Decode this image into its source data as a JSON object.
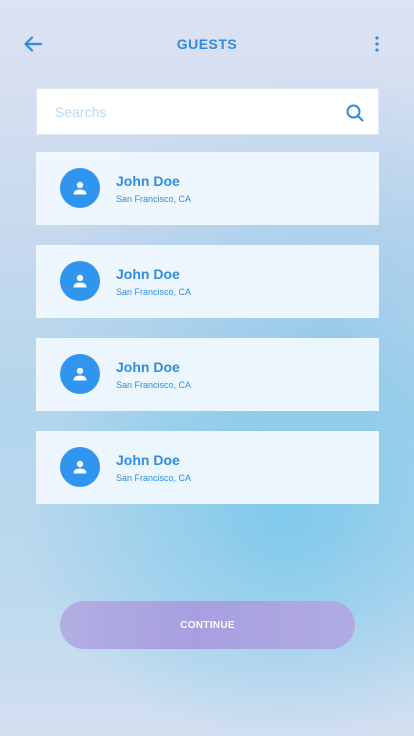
{
  "header": {
    "title": "GUESTS",
    "back_icon": "arrow-left-icon",
    "more_icon": "more-vertical-icon"
  },
  "search": {
    "placeholder": "Searchs",
    "value": "",
    "icon": "search-icon"
  },
  "guests": [
    {
      "name": "John Doe",
      "location": "San Francisco, CA",
      "avatar_icon": "person-icon"
    },
    {
      "name": "John Doe",
      "location": "San Francisco, CA",
      "avatar_icon": "person-icon"
    },
    {
      "name": "John Doe",
      "location": "San Francisco, CA",
      "avatar_icon": "person-icon"
    },
    {
      "name": "John Doe",
      "location": "San Francisco, CA",
      "avatar_icon": "person-icon"
    }
  ],
  "continue_button": {
    "label": "CONTINUE"
  },
  "colors": {
    "accent": "#2f8ddf",
    "avatar_bg": "#2f95ee",
    "button_bg": "#a79fe0"
  }
}
